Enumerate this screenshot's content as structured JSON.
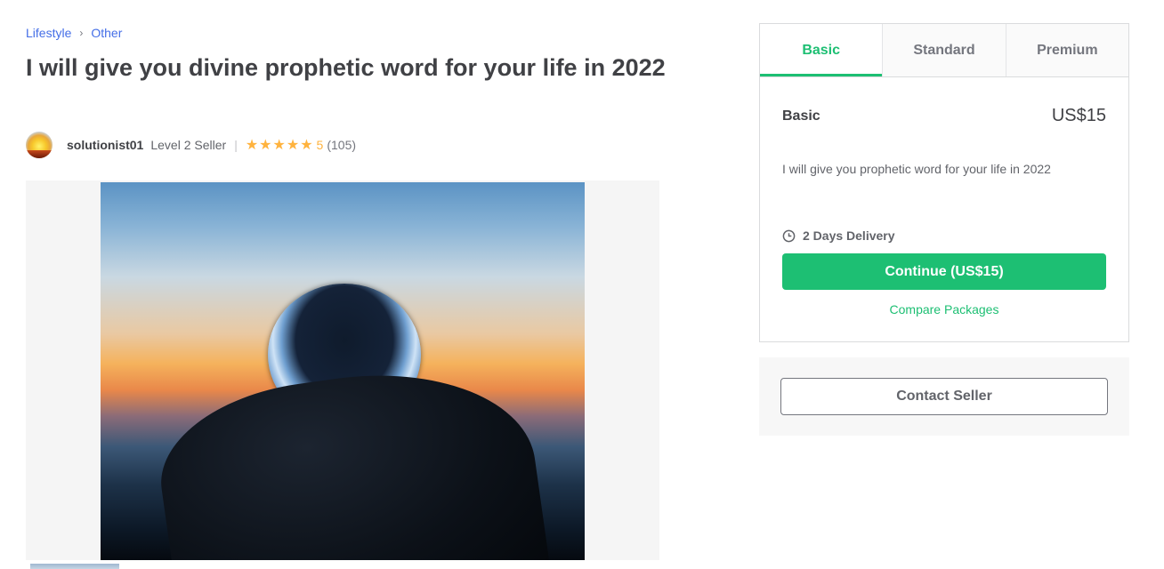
{
  "breadcrumb": {
    "items": [
      "Lifestyle",
      "Other"
    ],
    "separator": "›"
  },
  "gig": {
    "title": "I will give you divine prophetic word for your life in 2022"
  },
  "seller": {
    "username": "solutionist01",
    "level": "Level 2 Seller",
    "divider": "|",
    "stars": "★★★★★",
    "rating": "5",
    "review_count": "(105)"
  },
  "gallery": {
    "main_image_icon": "crystal-ball-sunset-photo"
  },
  "packages": {
    "tabs": [
      {
        "label": "Basic",
        "active": true
      },
      {
        "label": "Standard",
        "active": false
      },
      {
        "label": "Premium",
        "active": false
      }
    ],
    "selected": {
      "name": "Basic",
      "price": "US$15",
      "description": "I will give you prophetic word for your life in 2022",
      "delivery": "2 Days Delivery",
      "continue_label": "Continue (US$15)",
      "compare_label": "Compare Packages"
    }
  },
  "contact": {
    "button_label": "Contact Seller"
  },
  "colors": {
    "accent": "#1dbf73",
    "link": "#446ee7",
    "star": "#ffb33e",
    "text": "#404145"
  }
}
